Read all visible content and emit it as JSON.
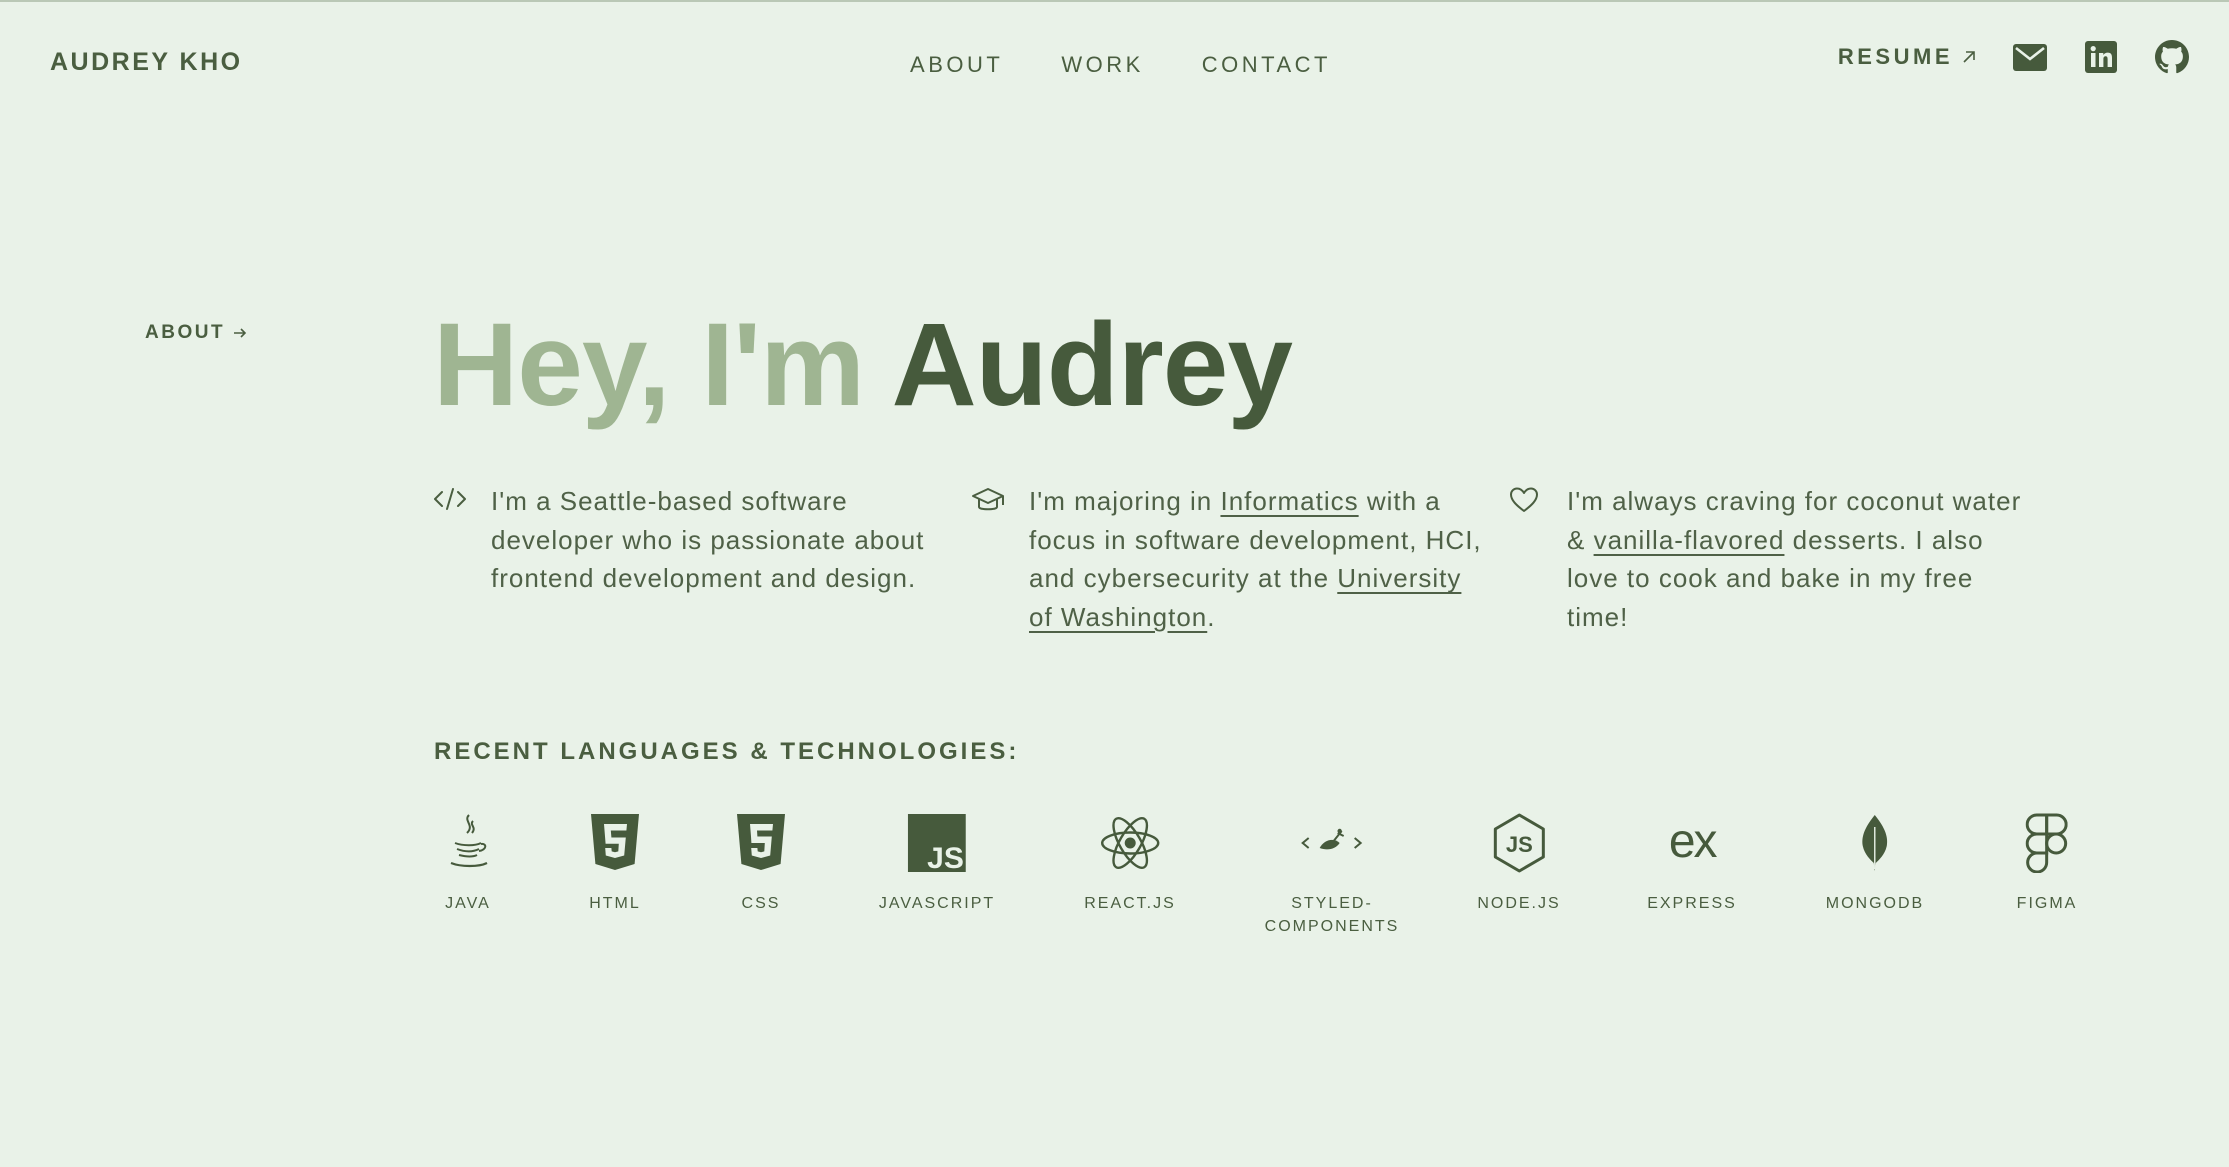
{
  "header": {
    "brand": "AUDREY KHO",
    "nav": [
      "ABOUT",
      "WORK",
      "CONTACT"
    ],
    "resume_label": "RESUME",
    "social_icons": [
      "mail-icon",
      "linkedin-icon",
      "github-icon"
    ]
  },
  "side_label": "ABOUT",
  "hero": {
    "greeting": "Hey, I'm",
    "name": "Audrey"
  },
  "intro": {
    "col1": {
      "icon": "code-icon",
      "text": "I'm a Seattle-based software developer who is passionate about frontend development and design."
    },
    "col2": {
      "icon": "graduation-cap-icon",
      "before": "I'm majoring in ",
      "link1": "Informatics",
      "middle": " with a focus in software development, HCI, and cybersecurity at the ",
      "link2": "University of Washington",
      "after": "."
    },
    "col3": {
      "icon": "heart-icon",
      "before": "I'm always craving for coconut water & ",
      "link": "vanilla-flavored",
      "after": " desserts. I also love to cook and bake in my free time!"
    }
  },
  "tech": {
    "title": "RECENT LANGUAGES & TECHNOLOGIES:",
    "items": [
      "JAVA",
      "HTML",
      "CSS",
      "JAVASCRIPT",
      "REACT.JS",
      "STYLED-\nCOMPONENTS",
      "NODE.JS",
      "EXPRESS",
      "MONGODB",
      "FIGMA"
    ]
  },
  "colors": {
    "background": "#e9f2e8",
    "text_dark": "#465a3c",
    "text_light": "#9fb592"
  }
}
